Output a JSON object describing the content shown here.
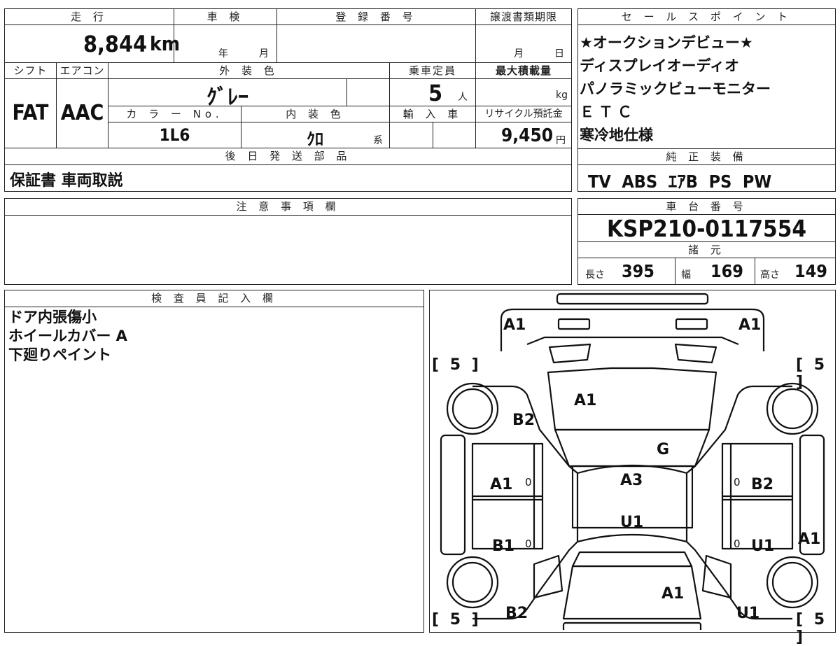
{
  "top_table": {
    "mileage": {
      "header": "走 行",
      "value": "8,844",
      "unit": "km"
    },
    "inspection": {
      "header": "車 検",
      "year_label": "年",
      "month_label": "月"
    },
    "registration": {
      "header": "登 録 番 号"
    },
    "transfer": {
      "header": "譲渡書類期限",
      "month_label": "月",
      "day_label": "日"
    },
    "shift": {
      "header": "シフト",
      "value": "FAT"
    },
    "aircon": {
      "header": "エアコン",
      "value": "AAC"
    },
    "exterior_color": {
      "header": "外 装 色",
      "value": "ｸﾞﾚｰ"
    },
    "capacity": {
      "header": "乗車定員",
      "value": "5",
      "unit": "人"
    },
    "max_load": {
      "header": "最大積載量",
      "unit": "kg"
    },
    "color_no": {
      "header": "カ ラ ー No.",
      "value": "1L6"
    },
    "interior_color": {
      "header": "内 装 色",
      "value": "ｸﾛ",
      "suffix": "系"
    },
    "import": {
      "header": "輸 入 車"
    },
    "recycle": {
      "header": "リサイクル預託金",
      "value": "9,450",
      "unit": "円"
    },
    "later_parts": {
      "header": "後 日 発 送 部 品",
      "value": "保証書 車両取説"
    }
  },
  "sales_points": {
    "header": "セ ー ル ス ポ イ ン ト",
    "items": [
      "★オークションデビュー★",
      "ディスプレイオーディオ",
      "パノラミックビューモニター",
      "ＥＴＣ",
      "寒冷地仕様"
    ]
  },
  "factory_equipment": {
    "header": "純 正 装 備",
    "value": "TV  ABS  ｴｱB  PS  PW"
  },
  "notes": {
    "header": "注 意 事 項 欄"
  },
  "chassis": {
    "header": "車 台 番 号",
    "value": "KSP210-0117554"
  },
  "dimensions": {
    "header": "諸 元",
    "length_label": "長さ",
    "length": "395",
    "width_label": "幅",
    "width": "169",
    "height_label": "高さ",
    "height": "149"
  },
  "inspector": {
    "header": "検 査 員 記 入 欄",
    "lines": [
      "ドア内張傷小",
      "ホイールカバー A",
      "下廻りペイント"
    ]
  },
  "diagram": {
    "tires": [
      "[ 5 ]",
      "[ 5 ]",
      "[ 5 ]",
      "[ 5 ]"
    ],
    "labels": {
      "front_left": "A1",
      "front_right": "A1",
      "hood": "A1",
      "front_fender_left": "B2",
      "windshield": "G",
      "roof": "A3",
      "roof_rear": "U1",
      "front_door_left": "A1",
      "front_door_right": "B2",
      "rear_door_left": "B1",
      "rear_door_right": "U1",
      "rear_quarter_right": "A1",
      "trunk": "A1",
      "rear_left": "B2",
      "rear_right": "U1"
    },
    "zero": "0"
  }
}
